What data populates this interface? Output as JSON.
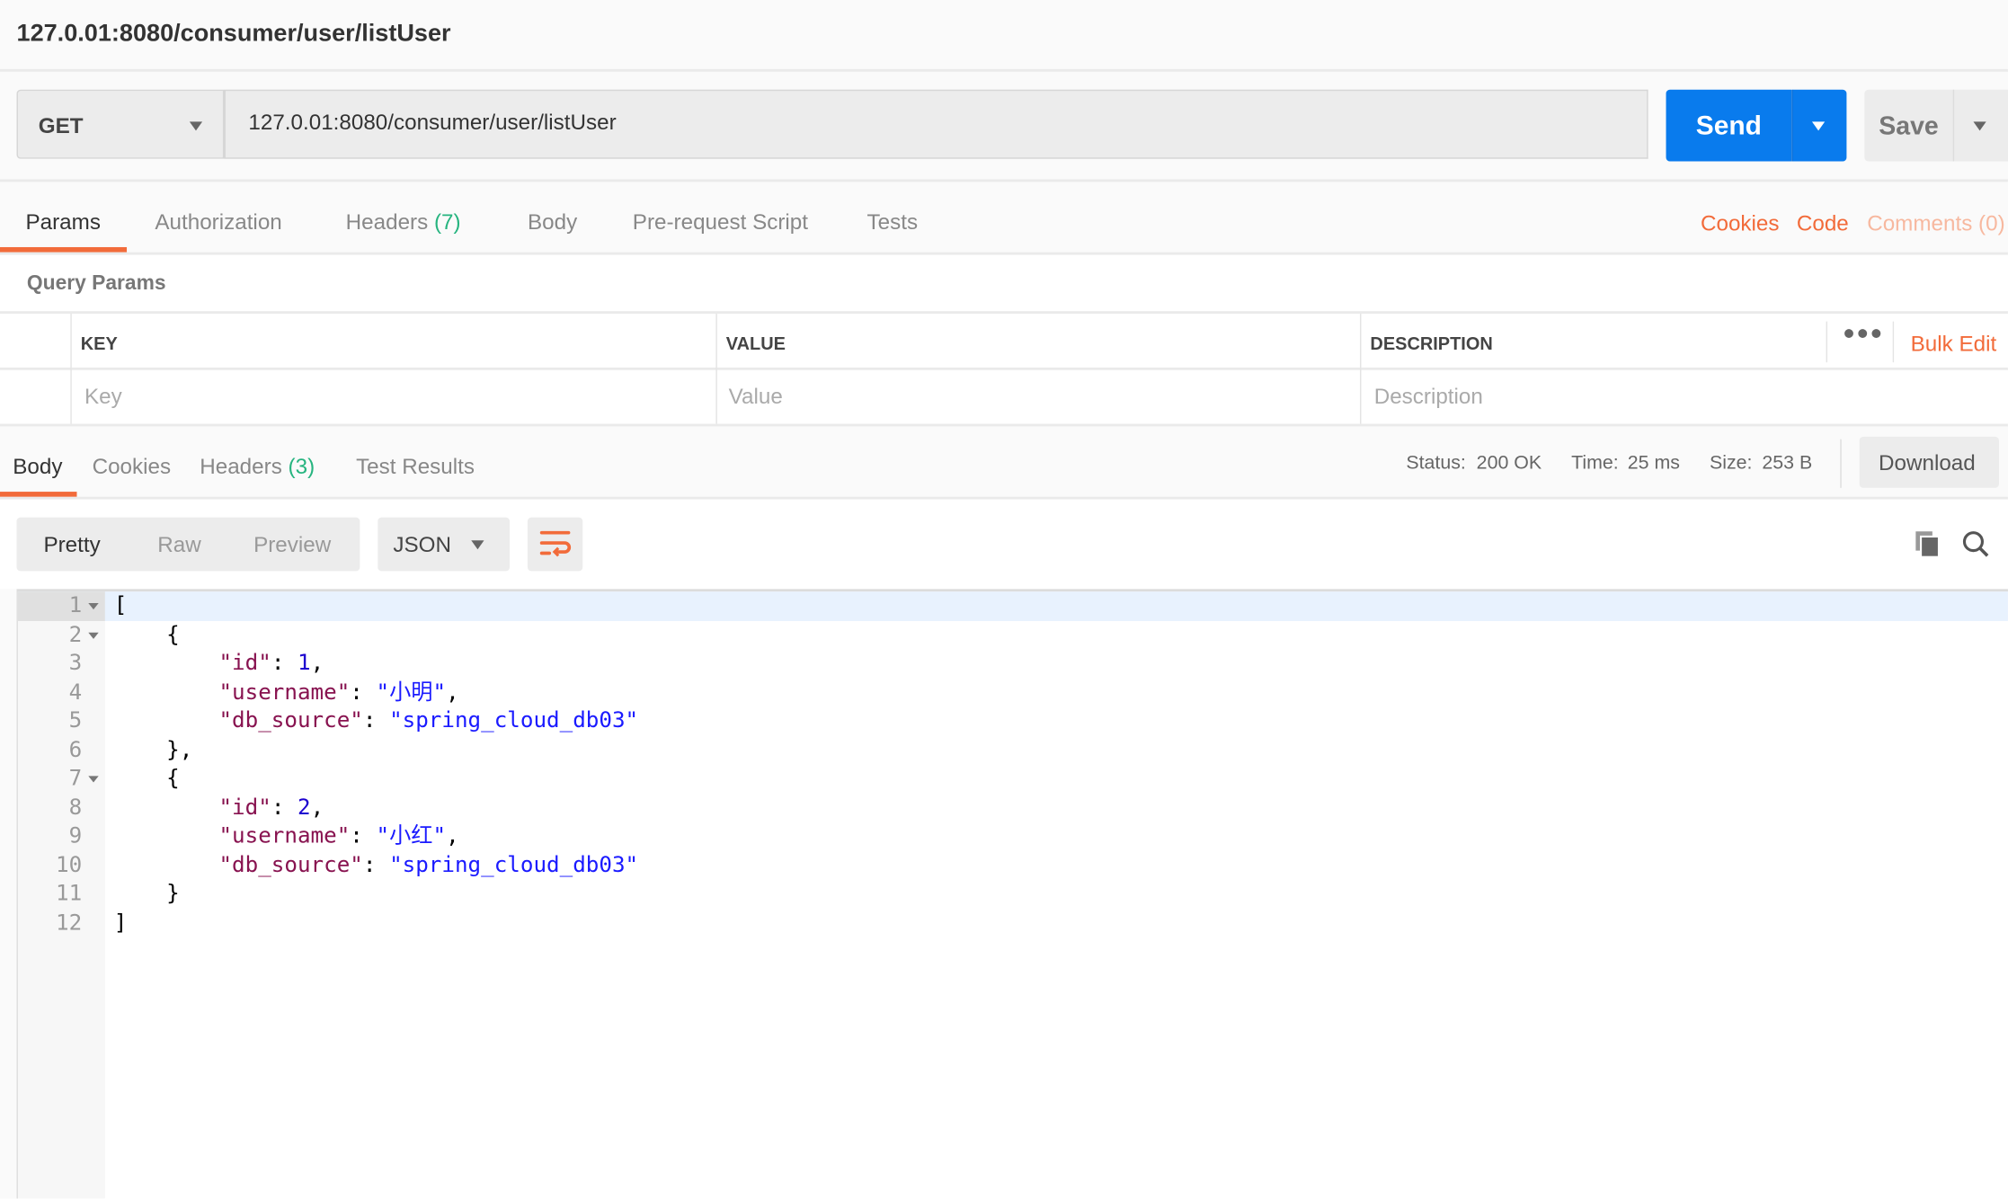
{
  "request": {
    "title": "127.0.01:8080/consumer/user/listUser",
    "method": "GET",
    "url": "127.0.01:8080/consumer/user/listUser",
    "send_label": "Send",
    "save_label": "Save"
  },
  "request_tabs": [
    {
      "label": "Params",
      "active": true
    },
    {
      "label": "Authorization"
    },
    {
      "label": "Headers",
      "count": "(7)"
    },
    {
      "label": "Body"
    },
    {
      "label": "Pre-request Script"
    },
    {
      "label": "Tests"
    }
  ],
  "right_links": {
    "cookies": "Cookies",
    "code": "Code",
    "comments": "Comments (0)"
  },
  "query_params": {
    "title": "Query Params",
    "columns": [
      "KEY",
      "VALUE",
      "DESCRIPTION"
    ],
    "placeholders": [
      "Key",
      "Value",
      "Description"
    ],
    "more_icon": "ellipsis-icon",
    "bulk_edit": "Bulk Edit"
  },
  "response_tabs": [
    {
      "label": "Body",
      "active": true
    },
    {
      "label": "Cookies"
    },
    {
      "label": "Headers",
      "count": "(3)"
    },
    {
      "label": "Test Results"
    }
  ],
  "status": {
    "status_label": "Status:",
    "status_value": "200 OK",
    "time_label": "Time:",
    "time_value": "25 ms",
    "size_label": "Size:",
    "size_value": "253 B",
    "download": "Download"
  },
  "view": {
    "modes": [
      "Pretty",
      "Raw",
      "Preview"
    ],
    "active_mode": "Pretty",
    "format": "JSON",
    "wrap_icon": "wrap-lines-icon",
    "copy_icon": "copy-icon",
    "search_icon": "search-icon"
  },
  "colors": {
    "accent": "#f26b3a",
    "send": "#097bed",
    "status_green": "#26b47f"
  },
  "code": {
    "lines": [
      [
        [
          "p",
          "["
        ]
      ],
      [
        [
          "p",
          "    {"
        ]
      ],
      [
        [
          "p",
          "        "
        ],
        [
          "k",
          "\"id\""
        ],
        [
          "p",
          ": "
        ],
        [
          "n",
          "1"
        ],
        [
          "p",
          ","
        ]
      ],
      [
        [
          "p",
          "        "
        ],
        [
          "k",
          "\"username\""
        ],
        [
          "p",
          ": "
        ],
        [
          "s",
          "\"小明\""
        ],
        [
          "p",
          ","
        ]
      ],
      [
        [
          "p",
          "        "
        ],
        [
          "k",
          "\"db_source\""
        ],
        [
          "p",
          ": "
        ],
        [
          "s",
          "\"spring_cloud_db03\""
        ]
      ],
      [
        [
          "p",
          "    },"
        ]
      ],
      [
        [
          "p",
          "    {"
        ]
      ],
      [
        [
          "p",
          "        "
        ],
        [
          "k",
          "\"id\""
        ],
        [
          "p",
          ": "
        ],
        [
          "n",
          "2"
        ],
        [
          "p",
          ","
        ]
      ],
      [
        [
          "p",
          "        "
        ],
        [
          "k",
          "\"username\""
        ],
        [
          "p",
          ": "
        ],
        [
          "s",
          "\"小红\""
        ],
        [
          "p",
          ","
        ]
      ],
      [
        [
          "p",
          "        "
        ],
        [
          "k",
          "\"db_source\""
        ],
        [
          "p",
          ": "
        ],
        [
          "s",
          "\"spring_cloud_db03\""
        ]
      ],
      [
        [
          "p",
          "    }"
        ]
      ],
      [
        [
          "p",
          "]"
        ]
      ]
    ],
    "foldable": [
      1,
      2,
      7
    ]
  }
}
